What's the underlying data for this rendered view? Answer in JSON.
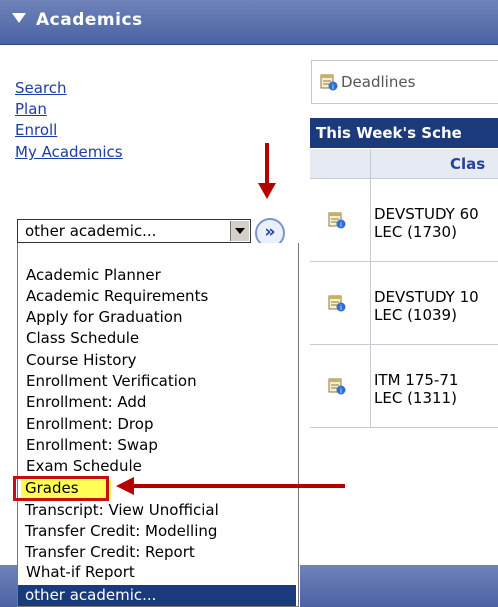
{
  "header": {
    "title": "Academics"
  },
  "links": [
    {
      "label": "Search"
    },
    {
      "label": "Plan"
    },
    {
      "label": "Enroll"
    },
    {
      "label": "My Academics"
    }
  ],
  "select": {
    "value": "other academic...",
    "options": [
      "Academic Planner",
      "Academic Requirements",
      "Apply for Graduation",
      "Class Schedule",
      "Course History",
      "Enrollment Verification",
      "Enrollment: Add",
      "Enrollment: Drop",
      "Enrollment: Swap",
      "Exam Schedule",
      "Grades",
      "Transcript: View Unofficial",
      "Transfer Credit: Modelling",
      "Transfer Credit: Report",
      "What-if Report",
      "other academic..."
    ],
    "go_symbol": "»"
  },
  "deadlines": {
    "label": "Deadlines"
  },
  "schedule": {
    "heading": "This Week's Sche",
    "column_header": "Clas",
    "rows": [
      {
        "line1": "DEVSTUDY 60",
        "line2": "LEC (1730)"
      },
      {
        "line1": "DEVSTUDY 10",
        "line2": "LEC (1039)"
      },
      {
        "line1": "ITM 175-71",
        "line2": "LEC (1311)"
      }
    ]
  },
  "colors": {
    "accent": "#1b3a7b",
    "annotation": "#b50000",
    "highlight": "#ffff57"
  }
}
